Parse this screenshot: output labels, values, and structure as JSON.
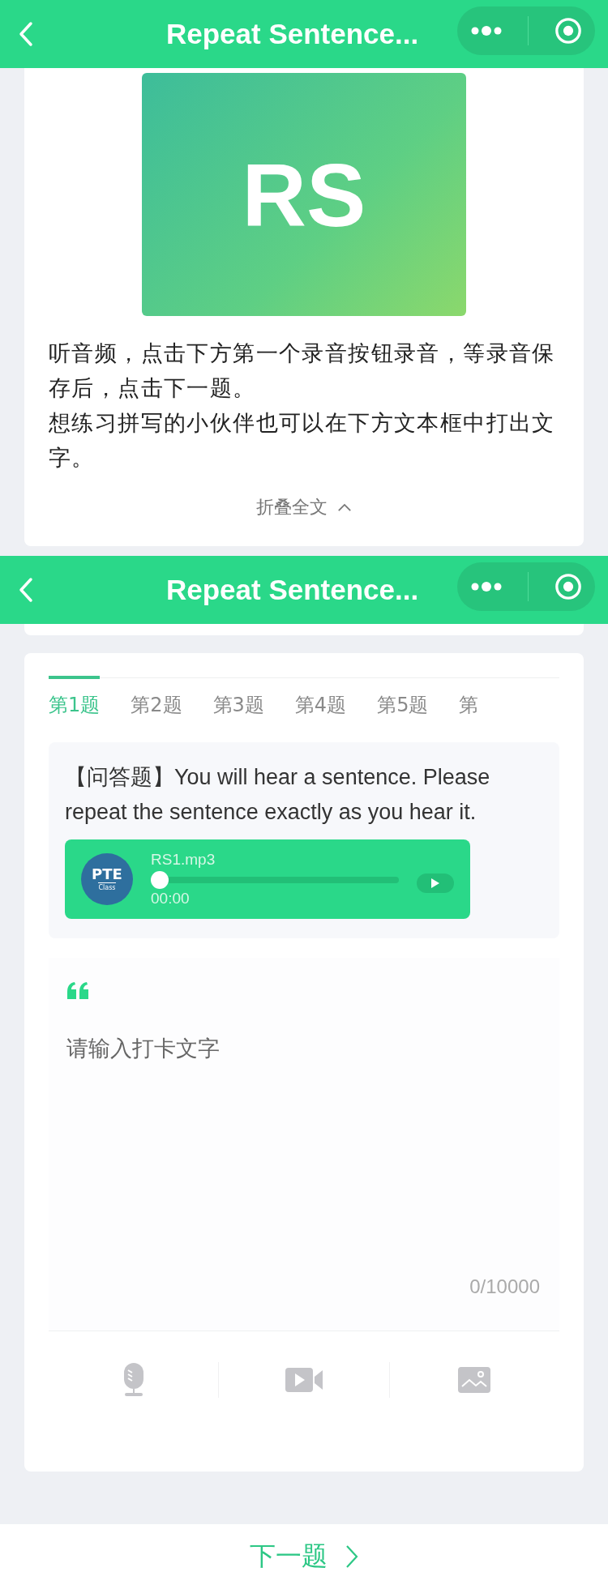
{
  "screens": [
    {
      "nav_bar": {
        "title": "Repeat Sentence..."
      },
      "kind": "intro"
    },
    {
      "nav_bar": {
        "title": "Repeat Sentence..."
      },
      "kind": "task"
    }
  ],
  "intro": {
    "cover_text": "RS",
    "paragraphs": [
      "听音频，点击下方第一个录音按钮录音，等录音保存后，点击下一题。",
      "想练习拼写的小伙伴也可以在下方文本框中打出文字。"
    ],
    "collapse_label": "折叠全文"
  },
  "tabs": [
    {
      "label": "第1题",
      "selected": true
    },
    {
      "label": "第2题",
      "selected": false
    },
    {
      "label": "第3题",
      "selected": false
    },
    {
      "label": "第4题",
      "selected": false
    },
    {
      "label": "第5题",
      "selected": false
    },
    {
      "label": "第",
      "selected": false
    }
  ],
  "question": {
    "text": "【问答题】You will hear a sentence. Please repeat the sentence exactly as you hear it.",
    "audio": {
      "logo_text": "PTE",
      "logo_subtext": "Class",
      "file_name": "RS1.mp3",
      "time": "00:00",
      "level": 0
    }
  },
  "answer": {
    "placeholder": "请输入打卡文字",
    "counter": "0/10000"
  },
  "attachments": [
    {
      "kind": "audio"
    },
    {
      "kind": "video"
    },
    {
      "kind": "image"
    }
  ],
  "next_button": {
    "label": "下一题"
  }
}
